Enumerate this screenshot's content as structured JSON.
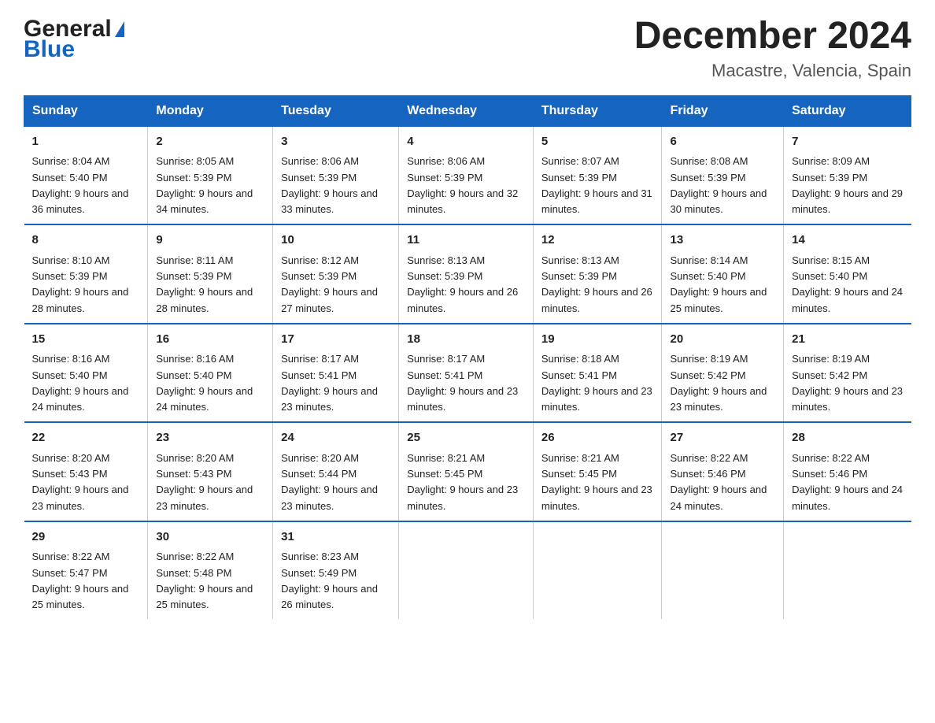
{
  "header": {
    "logo_general": "General",
    "logo_blue": "Blue",
    "title": "December 2024",
    "subtitle": "Macastre, Valencia, Spain"
  },
  "days_of_week": [
    "Sunday",
    "Monday",
    "Tuesday",
    "Wednesday",
    "Thursday",
    "Friday",
    "Saturday"
  ],
  "weeks": [
    [
      {
        "day": "1",
        "sunrise": "8:04 AM",
        "sunset": "5:40 PM",
        "daylight": "9 hours and 36 minutes."
      },
      {
        "day": "2",
        "sunrise": "8:05 AM",
        "sunset": "5:39 PM",
        "daylight": "9 hours and 34 minutes."
      },
      {
        "day": "3",
        "sunrise": "8:06 AM",
        "sunset": "5:39 PM",
        "daylight": "9 hours and 33 minutes."
      },
      {
        "day": "4",
        "sunrise": "8:06 AM",
        "sunset": "5:39 PM",
        "daylight": "9 hours and 32 minutes."
      },
      {
        "day": "5",
        "sunrise": "8:07 AM",
        "sunset": "5:39 PM",
        "daylight": "9 hours and 31 minutes."
      },
      {
        "day": "6",
        "sunrise": "8:08 AM",
        "sunset": "5:39 PM",
        "daylight": "9 hours and 30 minutes."
      },
      {
        "day": "7",
        "sunrise": "8:09 AM",
        "sunset": "5:39 PM",
        "daylight": "9 hours and 29 minutes."
      }
    ],
    [
      {
        "day": "8",
        "sunrise": "8:10 AM",
        "sunset": "5:39 PM",
        "daylight": "9 hours and 28 minutes."
      },
      {
        "day": "9",
        "sunrise": "8:11 AM",
        "sunset": "5:39 PM",
        "daylight": "9 hours and 28 minutes."
      },
      {
        "day": "10",
        "sunrise": "8:12 AM",
        "sunset": "5:39 PM",
        "daylight": "9 hours and 27 minutes."
      },
      {
        "day": "11",
        "sunrise": "8:13 AM",
        "sunset": "5:39 PM",
        "daylight": "9 hours and 26 minutes."
      },
      {
        "day": "12",
        "sunrise": "8:13 AM",
        "sunset": "5:39 PM",
        "daylight": "9 hours and 26 minutes."
      },
      {
        "day": "13",
        "sunrise": "8:14 AM",
        "sunset": "5:40 PM",
        "daylight": "9 hours and 25 minutes."
      },
      {
        "day": "14",
        "sunrise": "8:15 AM",
        "sunset": "5:40 PM",
        "daylight": "9 hours and 24 minutes."
      }
    ],
    [
      {
        "day": "15",
        "sunrise": "8:16 AM",
        "sunset": "5:40 PM",
        "daylight": "9 hours and 24 minutes."
      },
      {
        "day": "16",
        "sunrise": "8:16 AM",
        "sunset": "5:40 PM",
        "daylight": "9 hours and 24 minutes."
      },
      {
        "day": "17",
        "sunrise": "8:17 AM",
        "sunset": "5:41 PM",
        "daylight": "9 hours and 23 minutes."
      },
      {
        "day": "18",
        "sunrise": "8:17 AM",
        "sunset": "5:41 PM",
        "daylight": "9 hours and 23 minutes."
      },
      {
        "day": "19",
        "sunrise": "8:18 AM",
        "sunset": "5:41 PM",
        "daylight": "9 hours and 23 minutes."
      },
      {
        "day": "20",
        "sunrise": "8:19 AM",
        "sunset": "5:42 PM",
        "daylight": "9 hours and 23 minutes."
      },
      {
        "day": "21",
        "sunrise": "8:19 AM",
        "sunset": "5:42 PM",
        "daylight": "9 hours and 23 minutes."
      }
    ],
    [
      {
        "day": "22",
        "sunrise": "8:20 AM",
        "sunset": "5:43 PM",
        "daylight": "9 hours and 23 minutes."
      },
      {
        "day": "23",
        "sunrise": "8:20 AM",
        "sunset": "5:43 PM",
        "daylight": "9 hours and 23 minutes."
      },
      {
        "day": "24",
        "sunrise": "8:20 AM",
        "sunset": "5:44 PM",
        "daylight": "9 hours and 23 minutes."
      },
      {
        "day": "25",
        "sunrise": "8:21 AM",
        "sunset": "5:45 PM",
        "daylight": "9 hours and 23 minutes."
      },
      {
        "day": "26",
        "sunrise": "8:21 AM",
        "sunset": "5:45 PM",
        "daylight": "9 hours and 23 minutes."
      },
      {
        "day": "27",
        "sunrise": "8:22 AM",
        "sunset": "5:46 PM",
        "daylight": "9 hours and 24 minutes."
      },
      {
        "day": "28",
        "sunrise": "8:22 AM",
        "sunset": "5:46 PM",
        "daylight": "9 hours and 24 minutes."
      }
    ],
    [
      {
        "day": "29",
        "sunrise": "8:22 AM",
        "sunset": "5:47 PM",
        "daylight": "9 hours and 25 minutes."
      },
      {
        "day": "30",
        "sunrise": "8:22 AM",
        "sunset": "5:48 PM",
        "daylight": "9 hours and 25 minutes."
      },
      {
        "day": "31",
        "sunrise": "8:23 AM",
        "sunset": "5:49 PM",
        "daylight": "9 hours and 26 minutes."
      },
      null,
      null,
      null,
      null
    ]
  ],
  "labels": {
    "sunrise_prefix": "Sunrise: ",
    "sunset_prefix": "Sunset: ",
    "daylight_prefix": "Daylight: "
  }
}
